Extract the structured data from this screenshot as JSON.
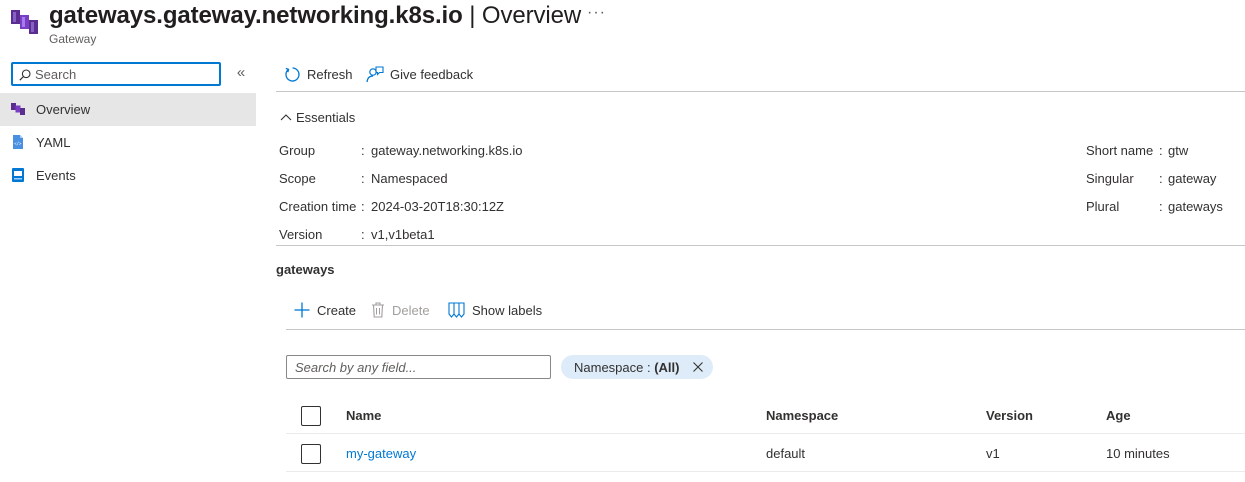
{
  "header": {
    "title_name": "gateways.gateway.networking.k8s.io",
    "title_sep": " | ",
    "title_page": "Overview",
    "subtitle": "Gateway",
    "more": "···"
  },
  "sidebar": {
    "search_placeholder": "Search",
    "collapse": "«",
    "items": [
      {
        "label": "Overview",
        "icon": "gateway-icon",
        "active": true
      },
      {
        "label": "YAML",
        "icon": "yaml-file-icon",
        "active": false
      },
      {
        "label": "Events",
        "icon": "events-icon",
        "active": false
      }
    ]
  },
  "commands": {
    "refresh": "Refresh",
    "feedback": "Give feedback"
  },
  "essentials": {
    "label": "Essentials",
    "left": [
      {
        "key": "Group",
        "value": "gateway.networking.k8s.io"
      },
      {
        "key": "Scope",
        "value": "Namespaced"
      },
      {
        "key": "Creation time",
        "value": "2024-03-20T18:30:12Z"
      },
      {
        "key": "Version",
        "value": "v1,v1beta1"
      }
    ],
    "right": [
      {
        "key": "Short name",
        "value": "gtw"
      },
      {
        "key": "Singular",
        "value": "gateway"
      },
      {
        "key": "Plural",
        "value": "gateways"
      }
    ]
  },
  "list": {
    "title": "gateways",
    "create": "Create",
    "delete": "Delete",
    "show_labels": "Show labels",
    "filter_placeholder": "Search by any field...",
    "namespace_pill": "Namespace : ",
    "namespace_value": "(All)",
    "columns": [
      "Name",
      "Namespace",
      "Version",
      "Age"
    ],
    "rows": [
      {
        "name": "my-gateway",
        "namespace": "default",
        "version": "v1",
        "age": "10 minutes"
      }
    ]
  },
  "colors": {
    "accent": "#0078d4",
    "gateway_icon": "#7a3ec2",
    "pill_bg": "#deecf9"
  }
}
